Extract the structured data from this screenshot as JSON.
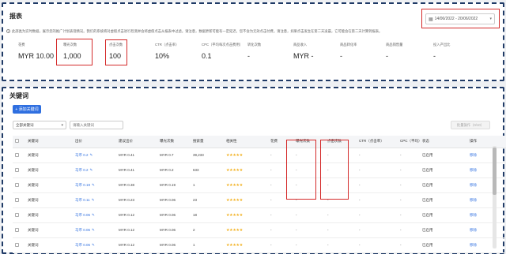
{
  "report": {
    "title": "报表",
    "date_range": "14/06/2022 - 20/06/2022",
    "info": "此部类为实时数据，展示您的推广计划表现情况。我们的系统将对虚假点击进行检测并会将虚假点击从报表中过滤。请注意，数据更新可能有一定延迟，您不会为无效点击付费。请注意，如果点击发生在第二天凌晨，它可能会在第二天计算到报表。",
    "metrics": [
      {
        "label": "花费",
        "value": "MYR 10.00"
      },
      {
        "label": "曝光次数",
        "value": "1,000"
      },
      {
        "label": "点击次数",
        "value": "100"
      },
      {
        "label": "CTR（点击率）",
        "value": "10%"
      },
      {
        "label": "CPC（平均每次点击费用）",
        "value": "0.1"
      },
      {
        "label": "转化次数",
        "value": "-"
      },
      {
        "label": "商品收入",
        "value": "MYR -"
      },
      {
        "label": "商品转化率",
        "value": "-"
      },
      {
        "label": "商品销售量",
        "value": "-"
      },
      {
        "label": "投入产出比",
        "value": "-"
      }
    ]
  },
  "keywords": {
    "title": "关键词",
    "add_button": "+ 添加关键词",
    "filter_select": "全部关键词",
    "search_placeholder": "请输入关键词",
    "batch_button": "批量操作（0/10）",
    "columns": [
      "关键词",
      "出价",
      "建议出价",
      "曝光次数",
      "搜索量",
      "相关性",
      "花费",
      "曝光次数",
      "点击次数",
      "CTR（点击率）",
      "CPC（平均）",
      "状态",
      "操作"
    ],
    "rows": [
      {
        "keyword": "关键词",
        "bid": "马币 0.2",
        "suggested": "MYR 0.41",
        "price": "MYR 0.7",
        "volume": "39,233",
        "relevance": "★★★★★",
        "cost": "-",
        "imp": "-",
        "clicks": "-",
        "ctr": "-",
        "cpc": "-",
        "status": "已启用",
        "action": "移除"
      },
      {
        "keyword": "关键词",
        "bid": "马币 0.2",
        "suggested": "MYR 0.41",
        "price": "MYR 0.2",
        "volume": "633",
        "relevance": "★★★★★",
        "cost": "-",
        "imp": "-",
        "clicks": "-",
        "ctr": "-",
        "cpc": "-",
        "status": "已启用",
        "action": "移除"
      },
      {
        "keyword": "关键词",
        "bid": "马币 0.19",
        "suggested": "MYR 0.38",
        "price": "MYR 0.19",
        "volume": "1",
        "relevance": "★★★★★",
        "cost": "-",
        "imp": "-",
        "clicks": "-",
        "ctr": "-",
        "cpc": "-",
        "status": "已启用",
        "action": "移除"
      },
      {
        "keyword": "关键词",
        "bid": "马币 0.11",
        "suggested": "MYR 0.23",
        "price": "MYR 0.06",
        "volume": "23",
        "relevance": "★★★★★",
        "cost": "-",
        "imp": "-",
        "clicks": "-",
        "ctr": "-",
        "cpc": "-",
        "status": "已启用",
        "action": "移除"
      },
      {
        "keyword": "关键词",
        "bid": "马币 0.06",
        "suggested": "MYR 0.12",
        "price": "MYR 0.06",
        "volume": "18",
        "relevance": "★★★★★",
        "cost": "-",
        "imp": "-",
        "clicks": "-",
        "ctr": "-",
        "cpc": "-",
        "status": "已启用",
        "action": "移除"
      },
      {
        "keyword": "关键词",
        "bid": "马币 0.06",
        "suggested": "MYR 0.12",
        "price": "MYR 0.06",
        "volume": "2",
        "relevance": "★★★★★",
        "cost": "-",
        "imp": "-",
        "clicks": "-",
        "ctr": "-",
        "cpc": "-",
        "status": "已启用",
        "action": "移除"
      },
      {
        "keyword": "关键词",
        "bid": "马币 0.06",
        "suggested": "MYR 0.12",
        "price": "MYR 0.06",
        "volume": "1",
        "relevance": "★★★★★",
        "cost": "-",
        "imp": "-",
        "clicks": "-",
        "ctr": "-",
        "cpc": "-",
        "status": "已启用",
        "action": "移除"
      }
    ]
  },
  "colors": {
    "accent": "#2f6fe0",
    "highlight": "#d42a2a",
    "stars": "#f2b01e",
    "frame": "#1f3a66"
  }
}
